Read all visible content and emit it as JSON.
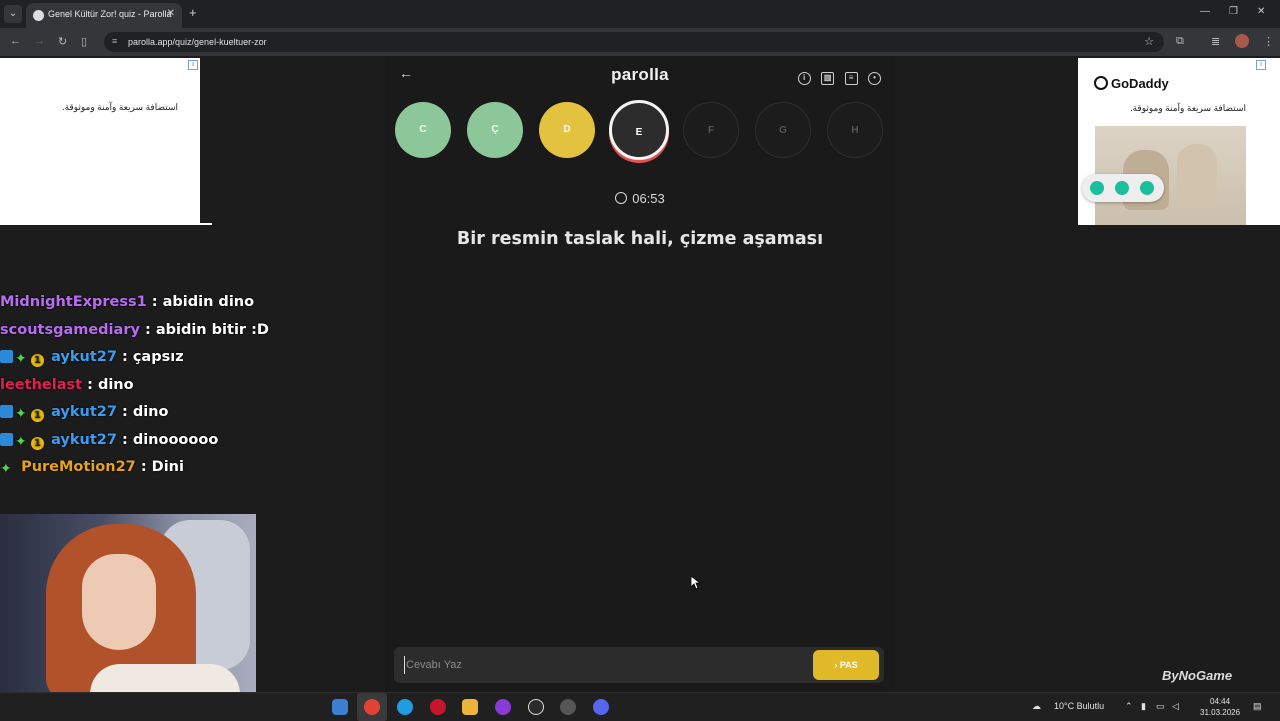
{
  "browser": {
    "tab_title": "Genel Kültür Zor! quiz - Parolla",
    "url": "parolla.app/quiz/genel-kueltuer-zor"
  },
  "ads": {
    "left_text": "استضافة سريعة وآمنة وموثوقة.",
    "right_brand": "GoDaddy",
    "right_text": "استضافة سريعة وآمنة وموثوقة.",
    "watermark": "ByNoGame"
  },
  "chat": [
    {
      "user": "MidnightExpress1",
      "color": "#b86cf2",
      "message": " : abidin dino",
      "badges": []
    },
    {
      "user": "scoutsgamediary",
      "color": "#b86cf2",
      "message": " : abidin bitir :D",
      "badges": []
    },
    {
      "user": "aykut27",
      "color": "#3b9cf0",
      "message": " : çapsız",
      "badges": [
        "blue",
        "green",
        "gold"
      ]
    },
    {
      "user": "leethelast",
      "color": "#e0204e",
      "message": " : dino",
      "badges": []
    },
    {
      "user": "aykut27",
      "color": "#3b9cf0",
      "message": " : dino",
      "badges": [
        "blue",
        "green",
        "gold"
      ]
    },
    {
      "user": "aykut27",
      "color": "#3b9cf0",
      "message": " : dinoooooo",
      "badges": [
        "blue",
        "green",
        "gold"
      ]
    },
    {
      "user": "PureMotion27",
      "color": "#e6a21e",
      "message": " : Dini",
      "badges": [
        "green"
      ]
    }
  ],
  "app": {
    "brand": "parolla",
    "timer": "06:53",
    "question": "Bir resmin taslak hali, çizme aşaması",
    "answer_placeholder": "Cevabı Yaz",
    "pass_label": "PAS",
    "letters": [
      {
        "letter": "C",
        "state": "correct"
      },
      {
        "letter": "Ç",
        "state": "correct"
      },
      {
        "letter": "D",
        "state": "wrong"
      },
      {
        "letter": "E",
        "state": "active"
      },
      {
        "letter": "F",
        "state": "pending"
      },
      {
        "letter": "G",
        "state": "pending"
      },
      {
        "letter": "H",
        "state": "pending"
      }
    ]
  },
  "taskbar": {
    "weather": "10°C Bulutlu",
    "time": "04:44",
    "date": "31.03.2026"
  }
}
